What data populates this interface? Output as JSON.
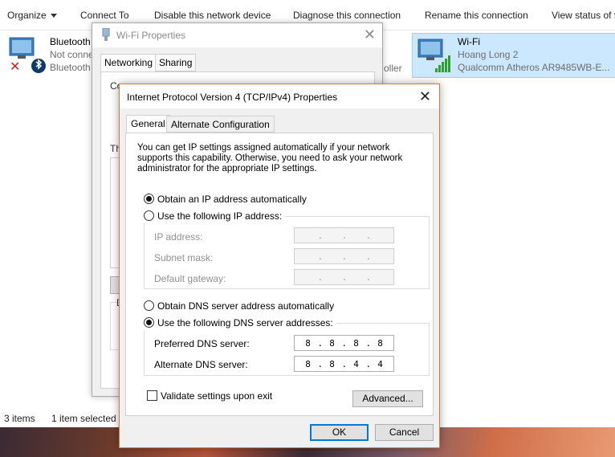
{
  "toolbar": {
    "organize": "Organize",
    "connect_to": "Connect To",
    "disable": "Disable this network device",
    "diagnose": "Diagnose this connection",
    "rename": "Rename this connection",
    "view_status": "View status of t"
  },
  "adapters": {
    "bluetooth": {
      "name": "Bluetooth",
      "status": "Not conne",
      "device": "Bluetooth",
      "icon": "bluetooth-icon"
    },
    "wifi": {
      "name": "Wi-Fi",
      "status": "Hoang Long  2",
      "device": "Qualcomm Atheros AR9485WB-E...",
      "icon": "wifi-adapter-icon"
    },
    "partial_text": "oller"
  },
  "status_bar": {
    "items": "3 items",
    "selected": "1 item selected"
  },
  "wifi_properties": {
    "title": "Wi-Fi Properties",
    "tabs": [
      "Networking",
      "Sharing"
    ],
    "fragments": {
      "co": "Co",
      "th": "Th",
      "d": "D"
    }
  },
  "ipv4": {
    "title": "Internet Protocol Version 4 (TCP/IPv4) Properties",
    "tabs": [
      "General",
      "Alternate Configuration"
    ],
    "intro": "You can get IP settings assigned automatically if your network supports this capability. Otherwise, you need to ask your network administrator for the appropriate IP settings.",
    "ip_auto": "Obtain an IP address automatically",
    "ip_manual": "Use the following IP address:",
    "ip_mode": "automatic",
    "ip_fields": {
      "ip_address": "IP address:",
      "subnet_mask": "Subnet mask:",
      "default_gateway": "Default gateway:"
    },
    "dns_auto": "Obtain DNS server address automatically",
    "dns_manual": "Use the following DNS server addresses:",
    "dns_mode": "manual",
    "preferred_dns_label": "Preferred DNS server:",
    "alternate_dns_label": "Alternate DNS server:",
    "preferred_dns": [
      "8",
      "8",
      "8",
      "8"
    ],
    "alternate_dns": [
      "8",
      "8",
      "4",
      "4"
    ],
    "validate_label": "Validate settings upon exit",
    "validate_checked": false,
    "advanced": "Advanced...",
    "ok": "OK",
    "cancel": "Cancel",
    "close_glyph": "✕"
  },
  "colors": {
    "selection_bg": "#cce8ff",
    "dialog_border": "#d47a3a",
    "default_button_border": "#0078d7"
  }
}
